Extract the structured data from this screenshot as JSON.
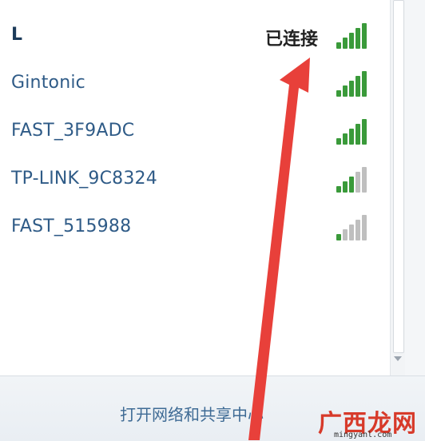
{
  "networks": [
    {
      "name": "L",
      "status": "已连接",
      "signal_bars": 5
    },
    {
      "name": "Gintonic",
      "status": "",
      "signal_bars": 5
    },
    {
      "name": "FAST_3F9ADC",
      "status": "",
      "signal_bars": 5
    },
    {
      "name": "TP-LINK_9C8324",
      "status": "",
      "signal_bars": 3
    },
    {
      "name": "FAST_515988",
      "status": "",
      "signal_bars": 1
    }
  ],
  "footer": {
    "open_network_center": "打开网络和共享中心"
  },
  "watermark": {
    "logo": "广西龙网",
    "url": "mingyanl.com"
  },
  "colors": {
    "signal_active": "#3a9a3a",
    "signal_inactive": "#bfbfbf",
    "link": "#3f6b95",
    "annotation_arrow": "#e8403a"
  }
}
